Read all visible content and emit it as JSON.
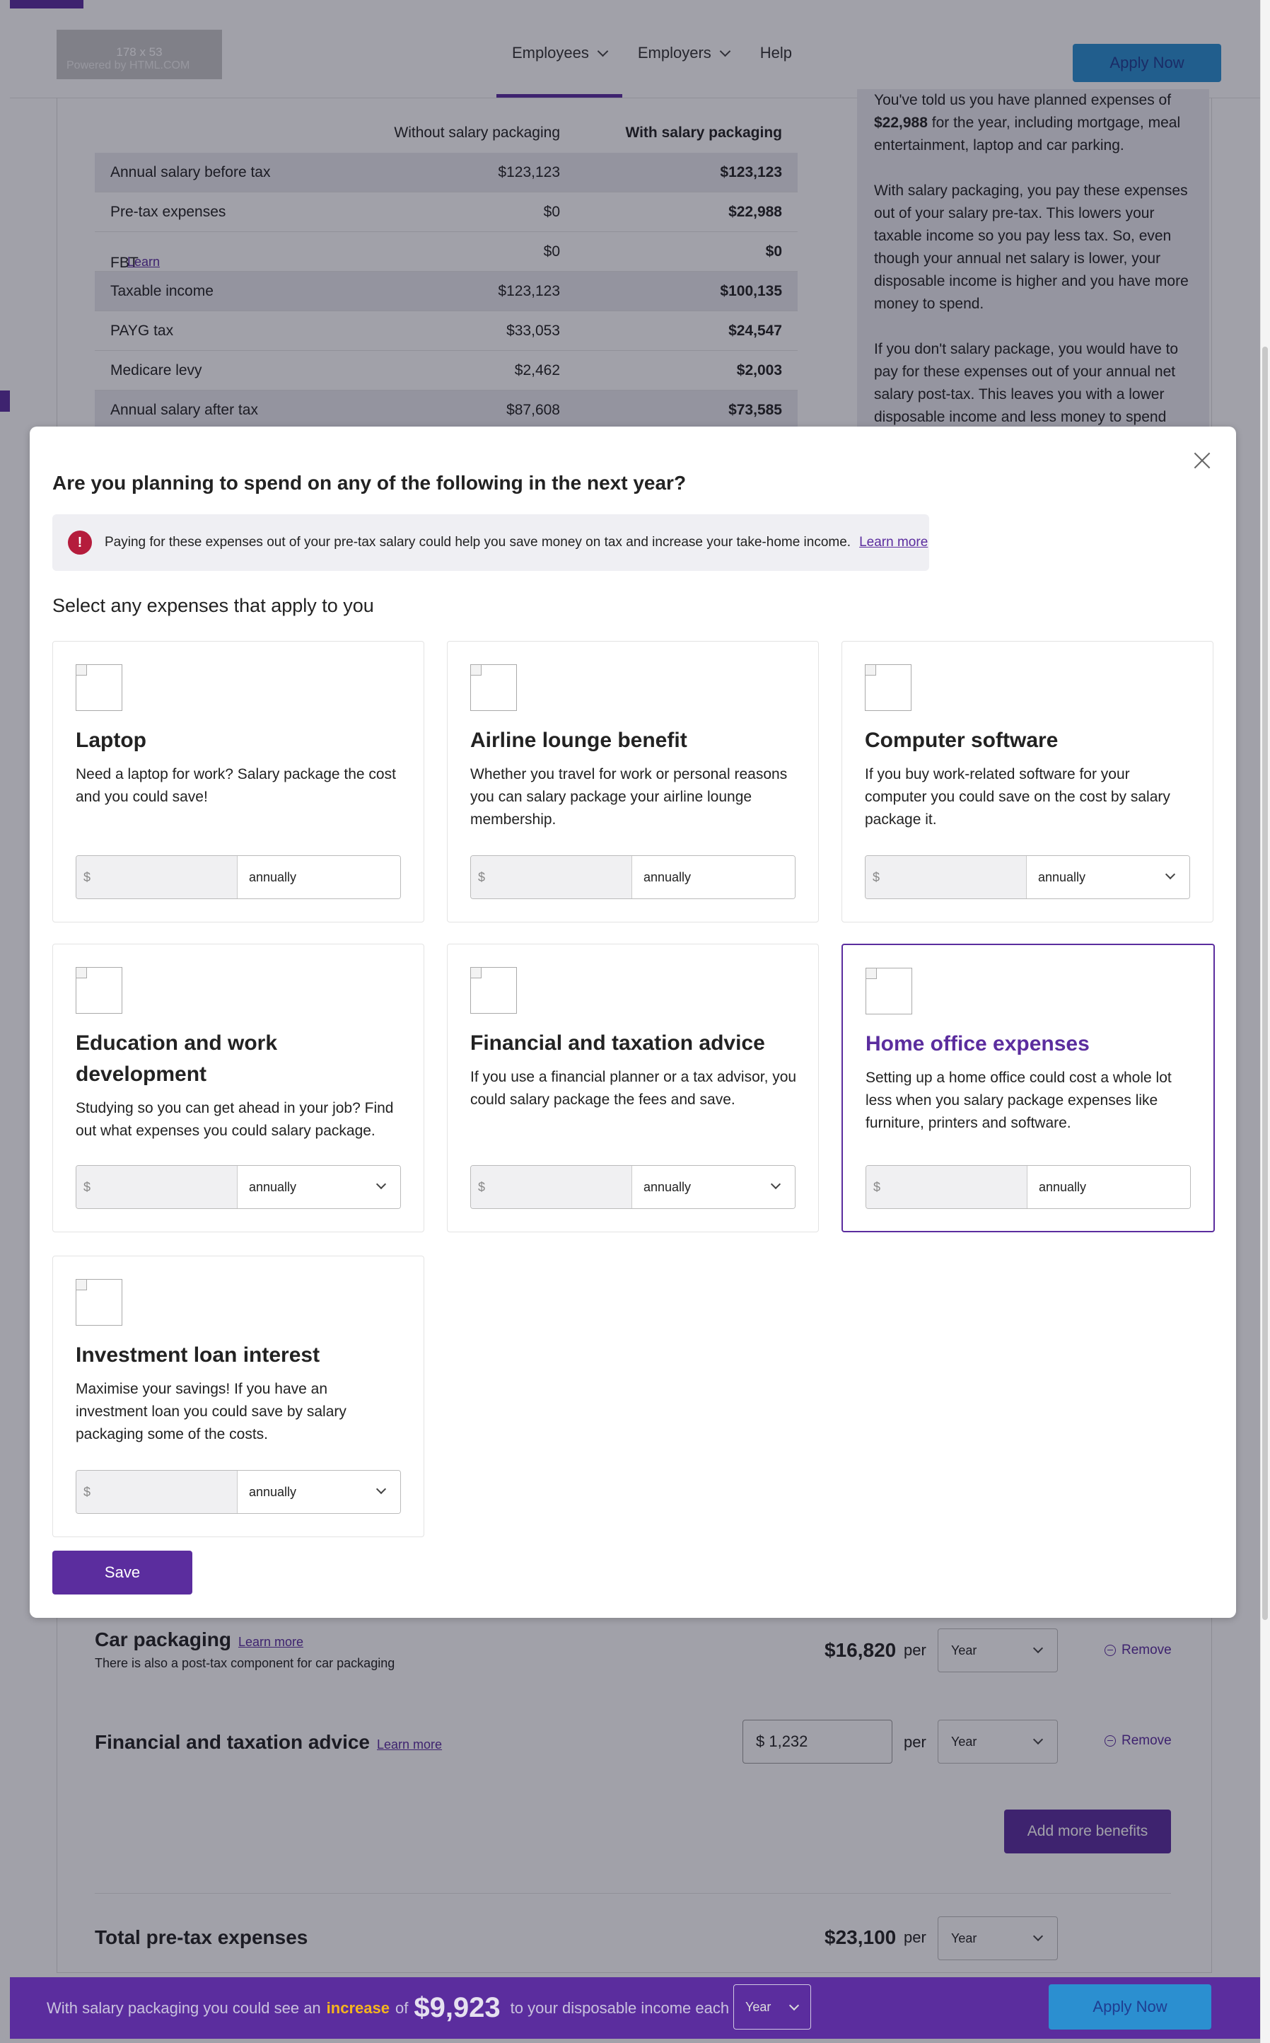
{
  "header": {
    "logo_line1": "178 x 53",
    "logo_line2": "Powered by HTML.COM",
    "nav": [
      {
        "label": "Employees"
      },
      {
        "label": "Employers"
      },
      {
        "label": "Help"
      }
    ],
    "apply_now": "Apply Now"
  },
  "comparison": {
    "col_without": "Without salary packaging",
    "col_with": "With salary packaging",
    "rows": [
      {
        "label": "Annual salary before tax",
        "without": "$123,123",
        "with": "$123,123"
      },
      {
        "label": "Pre-tax expenses",
        "without": "$0",
        "with": "$22,988"
      },
      {
        "label": "FBT payable",
        "learn": "Learn more",
        "without": "$0",
        "with": "$0"
      },
      {
        "label": "Taxable income",
        "without": "$123,123",
        "with": "$100,135"
      },
      {
        "label": "PAYG tax",
        "without": "$33,053",
        "with": "$24,547"
      },
      {
        "label": "Medicare levy",
        "without": "$2,462",
        "with": "$2,003"
      },
      {
        "label": "Annual salary after tax",
        "without": "$87,608",
        "with": "$73,585"
      }
    ]
  },
  "side_note": {
    "p1_a": "You've told us you have planned expenses of ",
    "p1_amount": "$22,988",
    "p1_b": " for the year, including mortgage, meal entertainment, laptop and car parking.",
    "p2": "With salary packaging, you pay these expenses out of your salary pre-tax. This lowers your taxable income so you pay less tax. So, even though your annual net salary is lower, your disposable income is higher and you have more money to spend.",
    "p3": "If you don't salary package, you would have to pay for these expenses out of your annual net salary post-tax. This leaves you with a lower disposable income and less money to spend"
  },
  "modal": {
    "title": "Are you planning to spend on any of the following in the next year?",
    "info_icon": "!",
    "info_text": "Paying for these expenses out of your pre-tax salary could help you save money on tax and increase your take-home income.",
    "info_learn": "Learn more",
    "select_label": "Select any expenses that apply to you",
    "currency_symbol": "$",
    "cards": [
      {
        "title": "Laptop",
        "desc": "Need a laptop for work? Salary package the cost and you could save!",
        "frequency": "annually",
        "dropdown": false,
        "selected": false,
        "icon": "image-placeholder-icon"
      },
      {
        "title": "Airline lounge benefit",
        "desc": "Whether you travel for work or personal reasons you can salary package your airline lounge membership.",
        "frequency": "annually",
        "dropdown": false,
        "selected": false,
        "icon": "image-placeholder-icon"
      },
      {
        "title": "Computer software",
        "desc": "If you buy work-related software for your computer you could save on the cost by salary package it.",
        "frequency": "annually",
        "dropdown": true,
        "selected": false,
        "icon": "image-placeholder-icon"
      },
      {
        "title": "Education and work development",
        "desc": "Studying so you can get ahead in your job? Find out what expenses you could salary package.",
        "frequency": "annually",
        "dropdown": true,
        "selected": false,
        "icon": "image-placeholder-icon"
      },
      {
        "title": "Financial and taxation advice",
        "desc": "If you use a financial planner or a tax advisor, you could salary package the fees and save.",
        "frequency": "annually",
        "dropdown": true,
        "selected": false,
        "icon": "image-placeholder-icon"
      },
      {
        "title": "Home office expenses",
        "desc": "Setting up a home office could cost a whole lot less when you salary package expenses like furniture, printers and software.",
        "frequency": "annually",
        "dropdown": false,
        "selected": true,
        "icon": "image-placeholder-icon"
      },
      {
        "title": "Investment loan interest",
        "desc": "Maximise your savings! If you have an investment loan you could save by salary packaging some of the costs.",
        "frequency": "annually",
        "dropdown": true,
        "selected": false,
        "icon": "image-placeholder-icon"
      }
    ],
    "save": "Save"
  },
  "benefits": {
    "car": {
      "title": "Car packaging",
      "learn": "Learn more",
      "sub": "There is also a post-tax component for car packaging",
      "amount": "$16,820",
      "per": "per",
      "period": "Year",
      "remove": "Remove"
    },
    "fin": {
      "title": "Financial and taxation advice",
      "learn": "Learn more",
      "input_value": "$ 1,232",
      "per": "per",
      "period": "Year",
      "remove": "Remove"
    },
    "add_more": "Add more benefits",
    "total": {
      "title": "Total pre-tax expenses",
      "amount": "$23,100",
      "per": "per",
      "period": "Year"
    }
  },
  "footer": {
    "text_a": "With salary packaging you could see an",
    "text_increase": "increase",
    "text_of": "of",
    "amount": "$9,923",
    "text_b": "to your disposable income each",
    "period": "Year",
    "apply_now": "Apply Now"
  },
  "colors": {
    "brand_purple": "#5b2d9e",
    "apply_blue": "#2b8fd0",
    "info_red": "#b51c3c",
    "increase_gold": "#f5b51d"
  }
}
